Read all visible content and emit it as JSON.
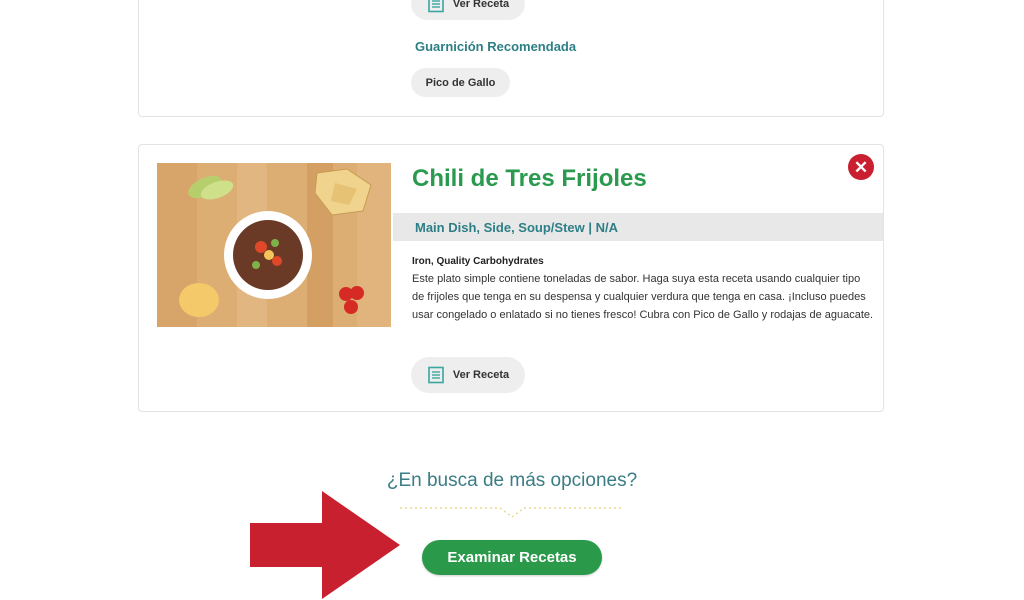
{
  "top_card": {
    "view_recipe_label": "Ver Receta",
    "side_heading": "Guarnición Recomendada",
    "side_dish_label": "Pico de Gallo"
  },
  "recipe": {
    "title": "Chili de Tres Frijoles",
    "category": "Main Dish, Side, Soup/Stew | N/A",
    "nutrients": "Iron, Quality Carbohydrates",
    "description": "Este plato simple contiene toneladas de sabor. Haga suya esta receta usando cualquier tipo de frijoles que tenga en su despensa y cualquier verdura que tenga en casa. ¡Incluso puedes usar congelado o enlatado si no tienes fresco! Cubra con Pico de Gallo y rodajas de aguacate.",
    "view_recipe_label": "Ver Receta",
    "close_icon": "close-icon"
  },
  "more_options": {
    "prompt": "¿En busca de más opciones?",
    "button_label": "Examinar Recetas"
  },
  "colors": {
    "title_green": "#2a9a4f",
    "teal": "#2d7f86",
    "close_red": "#c91f30",
    "button_green": "#2a9a4a",
    "arrow_red": "#c8202e"
  }
}
